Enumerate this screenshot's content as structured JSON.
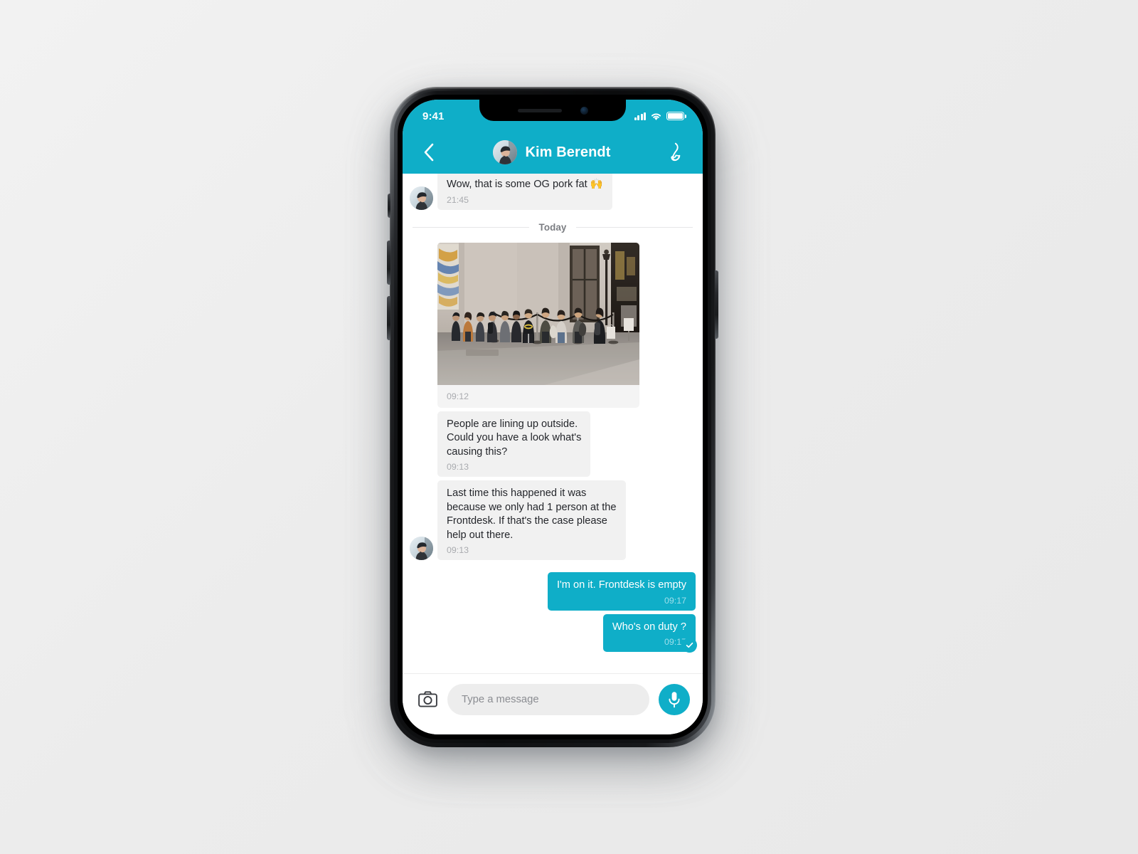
{
  "status_bar": {
    "time": "9:41",
    "signal_icon": "signal-bars-icon",
    "wifi_icon": "wifi-icon",
    "battery_icon": "battery-full-icon"
  },
  "header": {
    "back_icon": "chevron-left-icon",
    "avatar_icon": "contact-avatar",
    "title": "Kim Berendt",
    "call_icon": "phone-call-icon"
  },
  "conversation": {
    "day_divider": "Today",
    "messages": [
      {
        "id": "msg-1",
        "direction": "in",
        "type": "text",
        "text": "Wow, that is some OG pork fat 🙌",
        "time": "21:45",
        "clipped": true,
        "show_avatar": true
      },
      {
        "id": "msg-2",
        "direction": "in",
        "type": "image",
        "caption": "",
        "time": "09:12",
        "show_avatar": false,
        "image_alt": "People lining up outside a store"
      },
      {
        "id": "msg-3",
        "direction": "in",
        "type": "text",
        "text": "People are lining up outside.\nCould you have a look what's\ncausing this?",
        "time": "09:13",
        "show_avatar": false
      },
      {
        "id": "msg-4",
        "direction": "in",
        "type": "text",
        "text": "Last time this happened it was\nbecause we only had 1 person at the\nFrontdesk. If that's the case please\nhelp out there.",
        "time": "09:13",
        "show_avatar": true
      },
      {
        "id": "msg-5",
        "direction": "out",
        "type": "text",
        "text": "I'm on it. Frontdesk is empty",
        "time": "09:17"
      },
      {
        "id": "msg-6",
        "direction": "out",
        "type": "text",
        "text": "Who's on duty ?",
        "time": "09:17",
        "read_receipt": true,
        "read_receipt_icon": "check-circle-icon"
      }
    ]
  },
  "input_bar": {
    "camera_icon": "camera-icon",
    "placeholder": "Type a message",
    "value": "",
    "mic_icon": "microphone-icon"
  },
  "colors": {
    "accent": "#0FAEC8",
    "incoming_bubble": "#F1F1F1",
    "incoming_text": "#24262B",
    "outgoing_text": "#FFFFFF",
    "timestamp": "#A9ABAF",
    "page_background": "#F0F0F0"
  }
}
